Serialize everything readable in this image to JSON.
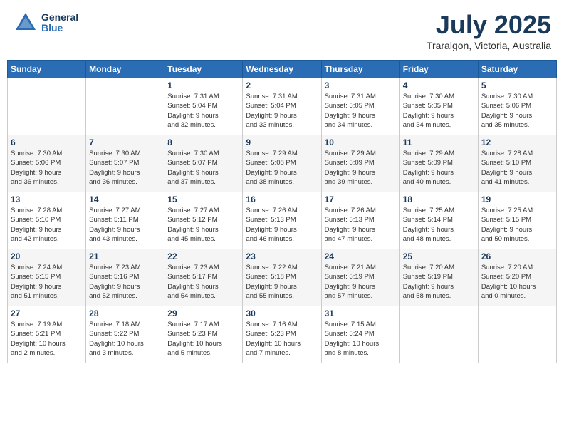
{
  "header": {
    "logo_general": "General",
    "logo_blue": "Blue",
    "month_year": "July 2025",
    "location": "Traralgon, Victoria, Australia"
  },
  "weekdays": [
    "Sunday",
    "Monday",
    "Tuesday",
    "Wednesday",
    "Thursday",
    "Friday",
    "Saturday"
  ],
  "weeks": [
    [
      {
        "day": "",
        "detail": ""
      },
      {
        "day": "",
        "detail": ""
      },
      {
        "day": "1",
        "detail": "Sunrise: 7:31 AM\nSunset: 5:04 PM\nDaylight: 9 hours\nand 32 minutes."
      },
      {
        "day": "2",
        "detail": "Sunrise: 7:31 AM\nSunset: 5:04 PM\nDaylight: 9 hours\nand 33 minutes."
      },
      {
        "day": "3",
        "detail": "Sunrise: 7:31 AM\nSunset: 5:05 PM\nDaylight: 9 hours\nand 34 minutes."
      },
      {
        "day": "4",
        "detail": "Sunrise: 7:30 AM\nSunset: 5:05 PM\nDaylight: 9 hours\nand 34 minutes."
      },
      {
        "day": "5",
        "detail": "Sunrise: 7:30 AM\nSunset: 5:06 PM\nDaylight: 9 hours\nand 35 minutes."
      }
    ],
    [
      {
        "day": "6",
        "detail": "Sunrise: 7:30 AM\nSunset: 5:06 PM\nDaylight: 9 hours\nand 36 minutes."
      },
      {
        "day": "7",
        "detail": "Sunrise: 7:30 AM\nSunset: 5:07 PM\nDaylight: 9 hours\nand 36 minutes."
      },
      {
        "day": "8",
        "detail": "Sunrise: 7:30 AM\nSunset: 5:07 PM\nDaylight: 9 hours\nand 37 minutes."
      },
      {
        "day": "9",
        "detail": "Sunrise: 7:29 AM\nSunset: 5:08 PM\nDaylight: 9 hours\nand 38 minutes."
      },
      {
        "day": "10",
        "detail": "Sunrise: 7:29 AM\nSunset: 5:09 PM\nDaylight: 9 hours\nand 39 minutes."
      },
      {
        "day": "11",
        "detail": "Sunrise: 7:29 AM\nSunset: 5:09 PM\nDaylight: 9 hours\nand 40 minutes."
      },
      {
        "day": "12",
        "detail": "Sunrise: 7:28 AM\nSunset: 5:10 PM\nDaylight: 9 hours\nand 41 minutes."
      }
    ],
    [
      {
        "day": "13",
        "detail": "Sunrise: 7:28 AM\nSunset: 5:10 PM\nDaylight: 9 hours\nand 42 minutes."
      },
      {
        "day": "14",
        "detail": "Sunrise: 7:27 AM\nSunset: 5:11 PM\nDaylight: 9 hours\nand 43 minutes."
      },
      {
        "day": "15",
        "detail": "Sunrise: 7:27 AM\nSunset: 5:12 PM\nDaylight: 9 hours\nand 45 minutes."
      },
      {
        "day": "16",
        "detail": "Sunrise: 7:26 AM\nSunset: 5:13 PM\nDaylight: 9 hours\nand 46 minutes."
      },
      {
        "day": "17",
        "detail": "Sunrise: 7:26 AM\nSunset: 5:13 PM\nDaylight: 9 hours\nand 47 minutes."
      },
      {
        "day": "18",
        "detail": "Sunrise: 7:25 AM\nSunset: 5:14 PM\nDaylight: 9 hours\nand 48 minutes."
      },
      {
        "day": "19",
        "detail": "Sunrise: 7:25 AM\nSunset: 5:15 PM\nDaylight: 9 hours\nand 50 minutes."
      }
    ],
    [
      {
        "day": "20",
        "detail": "Sunrise: 7:24 AM\nSunset: 5:15 PM\nDaylight: 9 hours\nand 51 minutes."
      },
      {
        "day": "21",
        "detail": "Sunrise: 7:23 AM\nSunset: 5:16 PM\nDaylight: 9 hours\nand 52 minutes."
      },
      {
        "day": "22",
        "detail": "Sunrise: 7:23 AM\nSunset: 5:17 PM\nDaylight: 9 hours\nand 54 minutes."
      },
      {
        "day": "23",
        "detail": "Sunrise: 7:22 AM\nSunset: 5:18 PM\nDaylight: 9 hours\nand 55 minutes."
      },
      {
        "day": "24",
        "detail": "Sunrise: 7:21 AM\nSunset: 5:19 PM\nDaylight: 9 hours\nand 57 minutes."
      },
      {
        "day": "25",
        "detail": "Sunrise: 7:20 AM\nSunset: 5:19 PM\nDaylight: 9 hours\nand 58 minutes."
      },
      {
        "day": "26",
        "detail": "Sunrise: 7:20 AM\nSunset: 5:20 PM\nDaylight: 10 hours\nand 0 minutes."
      }
    ],
    [
      {
        "day": "27",
        "detail": "Sunrise: 7:19 AM\nSunset: 5:21 PM\nDaylight: 10 hours\nand 2 minutes."
      },
      {
        "day": "28",
        "detail": "Sunrise: 7:18 AM\nSunset: 5:22 PM\nDaylight: 10 hours\nand 3 minutes."
      },
      {
        "day": "29",
        "detail": "Sunrise: 7:17 AM\nSunset: 5:23 PM\nDaylight: 10 hours\nand 5 minutes."
      },
      {
        "day": "30",
        "detail": "Sunrise: 7:16 AM\nSunset: 5:23 PM\nDaylight: 10 hours\nand 7 minutes."
      },
      {
        "day": "31",
        "detail": "Sunrise: 7:15 AM\nSunset: 5:24 PM\nDaylight: 10 hours\nand 8 minutes."
      },
      {
        "day": "",
        "detail": ""
      },
      {
        "day": "",
        "detail": ""
      }
    ]
  ]
}
